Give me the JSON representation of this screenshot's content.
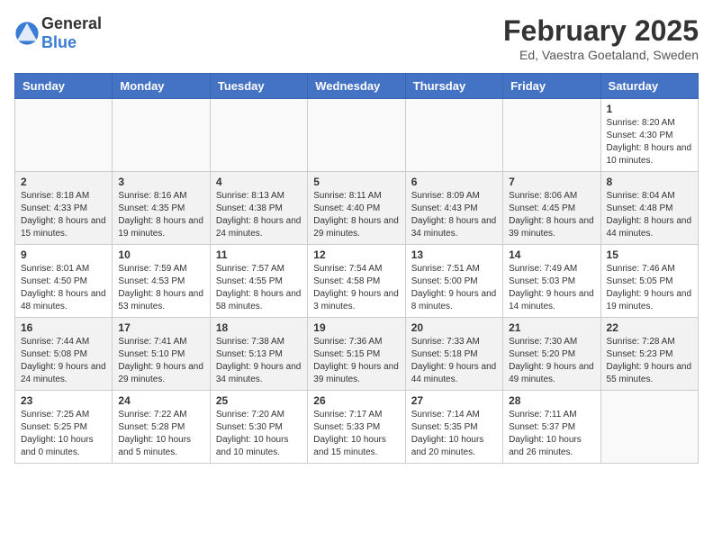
{
  "header": {
    "logo": {
      "general": "General",
      "blue": "Blue"
    },
    "title": "February 2025",
    "location": "Ed, Vaestra Goetaland, Sweden"
  },
  "days_of_week": [
    "Sunday",
    "Monday",
    "Tuesday",
    "Wednesday",
    "Thursday",
    "Friday",
    "Saturday"
  ],
  "weeks": [
    [
      {
        "day": "",
        "info": ""
      },
      {
        "day": "",
        "info": ""
      },
      {
        "day": "",
        "info": ""
      },
      {
        "day": "",
        "info": ""
      },
      {
        "day": "",
        "info": ""
      },
      {
        "day": "",
        "info": ""
      },
      {
        "day": "1",
        "info": "Sunrise: 8:20 AM\nSunset: 4:30 PM\nDaylight: 8 hours and 10 minutes."
      }
    ],
    [
      {
        "day": "2",
        "info": "Sunrise: 8:18 AM\nSunset: 4:33 PM\nDaylight: 8 hours and 15 minutes."
      },
      {
        "day": "3",
        "info": "Sunrise: 8:16 AM\nSunset: 4:35 PM\nDaylight: 8 hours and 19 minutes."
      },
      {
        "day": "4",
        "info": "Sunrise: 8:13 AM\nSunset: 4:38 PM\nDaylight: 8 hours and 24 minutes."
      },
      {
        "day": "5",
        "info": "Sunrise: 8:11 AM\nSunset: 4:40 PM\nDaylight: 8 hours and 29 minutes."
      },
      {
        "day": "6",
        "info": "Sunrise: 8:09 AM\nSunset: 4:43 PM\nDaylight: 8 hours and 34 minutes."
      },
      {
        "day": "7",
        "info": "Sunrise: 8:06 AM\nSunset: 4:45 PM\nDaylight: 8 hours and 39 minutes."
      },
      {
        "day": "8",
        "info": "Sunrise: 8:04 AM\nSunset: 4:48 PM\nDaylight: 8 hours and 44 minutes."
      }
    ],
    [
      {
        "day": "9",
        "info": "Sunrise: 8:01 AM\nSunset: 4:50 PM\nDaylight: 8 hours and 48 minutes."
      },
      {
        "day": "10",
        "info": "Sunrise: 7:59 AM\nSunset: 4:53 PM\nDaylight: 8 hours and 53 minutes."
      },
      {
        "day": "11",
        "info": "Sunrise: 7:57 AM\nSunset: 4:55 PM\nDaylight: 8 hours and 58 minutes."
      },
      {
        "day": "12",
        "info": "Sunrise: 7:54 AM\nSunset: 4:58 PM\nDaylight: 9 hours and 3 minutes."
      },
      {
        "day": "13",
        "info": "Sunrise: 7:51 AM\nSunset: 5:00 PM\nDaylight: 9 hours and 8 minutes."
      },
      {
        "day": "14",
        "info": "Sunrise: 7:49 AM\nSunset: 5:03 PM\nDaylight: 9 hours and 14 minutes."
      },
      {
        "day": "15",
        "info": "Sunrise: 7:46 AM\nSunset: 5:05 PM\nDaylight: 9 hours and 19 minutes."
      }
    ],
    [
      {
        "day": "16",
        "info": "Sunrise: 7:44 AM\nSunset: 5:08 PM\nDaylight: 9 hours and 24 minutes."
      },
      {
        "day": "17",
        "info": "Sunrise: 7:41 AM\nSunset: 5:10 PM\nDaylight: 9 hours and 29 minutes."
      },
      {
        "day": "18",
        "info": "Sunrise: 7:38 AM\nSunset: 5:13 PM\nDaylight: 9 hours and 34 minutes."
      },
      {
        "day": "19",
        "info": "Sunrise: 7:36 AM\nSunset: 5:15 PM\nDaylight: 9 hours and 39 minutes."
      },
      {
        "day": "20",
        "info": "Sunrise: 7:33 AM\nSunset: 5:18 PM\nDaylight: 9 hours and 44 minutes."
      },
      {
        "day": "21",
        "info": "Sunrise: 7:30 AM\nSunset: 5:20 PM\nDaylight: 9 hours and 49 minutes."
      },
      {
        "day": "22",
        "info": "Sunrise: 7:28 AM\nSunset: 5:23 PM\nDaylight: 9 hours and 55 minutes."
      }
    ],
    [
      {
        "day": "23",
        "info": "Sunrise: 7:25 AM\nSunset: 5:25 PM\nDaylight: 10 hours and 0 minutes."
      },
      {
        "day": "24",
        "info": "Sunrise: 7:22 AM\nSunset: 5:28 PM\nDaylight: 10 hours and 5 minutes."
      },
      {
        "day": "25",
        "info": "Sunrise: 7:20 AM\nSunset: 5:30 PM\nDaylight: 10 hours and 10 minutes."
      },
      {
        "day": "26",
        "info": "Sunrise: 7:17 AM\nSunset: 5:33 PM\nDaylight: 10 hours and 15 minutes."
      },
      {
        "day": "27",
        "info": "Sunrise: 7:14 AM\nSunset: 5:35 PM\nDaylight: 10 hours and 20 minutes."
      },
      {
        "day": "28",
        "info": "Sunrise: 7:11 AM\nSunset: 5:37 PM\nDaylight: 10 hours and 26 minutes."
      },
      {
        "day": "",
        "info": ""
      }
    ]
  ]
}
